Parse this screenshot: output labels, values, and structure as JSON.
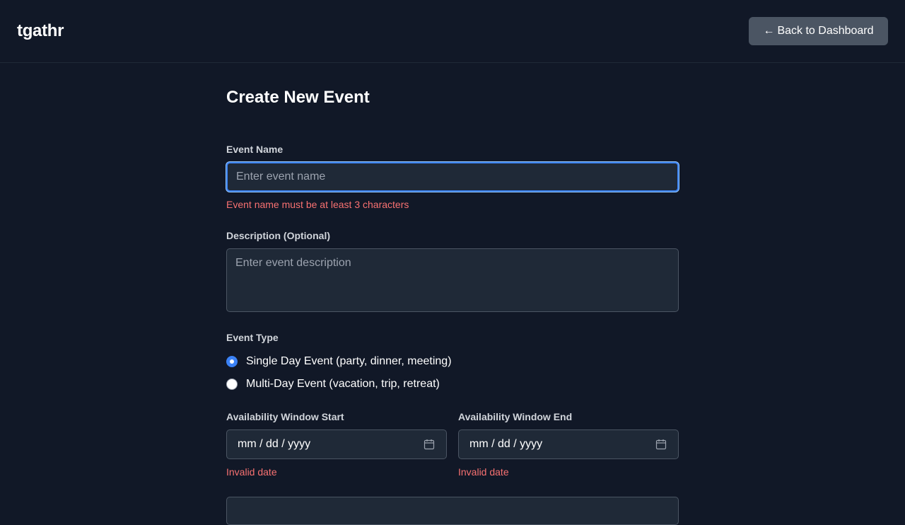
{
  "header": {
    "brand": "tgathr",
    "back_button": {
      "icon": "left-arrow-icon",
      "arrow": "←",
      "label": "Back to Dashboard"
    }
  },
  "form": {
    "title": "Create New Event",
    "event_name": {
      "label": "Event Name",
      "value": "",
      "placeholder": "Enter event name",
      "error": "Event name must be at least 3 characters"
    },
    "description": {
      "label": "Description (Optional)",
      "value": "",
      "placeholder": "Enter event description"
    },
    "event_type": {
      "label": "Event Type",
      "options": [
        {
          "label": "Single Day Event (party, dinner, meeting)",
          "checked": true
        },
        {
          "label": "Multi-Day Event (vacation, trip, retreat)",
          "checked": false
        }
      ]
    },
    "availability_start": {
      "label": "Availability Window Start",
      "placeholder": "mm / dd / yyyy",
      "icon": "calendar-icon",
      "error": "Invalid date"
    },
    "availability_end": {
      "label": "Availability Window End",
      "placeholder": "mm / dd / yyyy",
      "icon": "calendar-icon",
      "error": "Invalid date"
    }
  },
  "colors": {
    "background": "#111827",
    "input_background": "#1f2937",
    "border": "#4b5563",
    "accent": "#3b82f6",
    "error": "#f87171",
    "button_background": "#4b5563"
  }
}
